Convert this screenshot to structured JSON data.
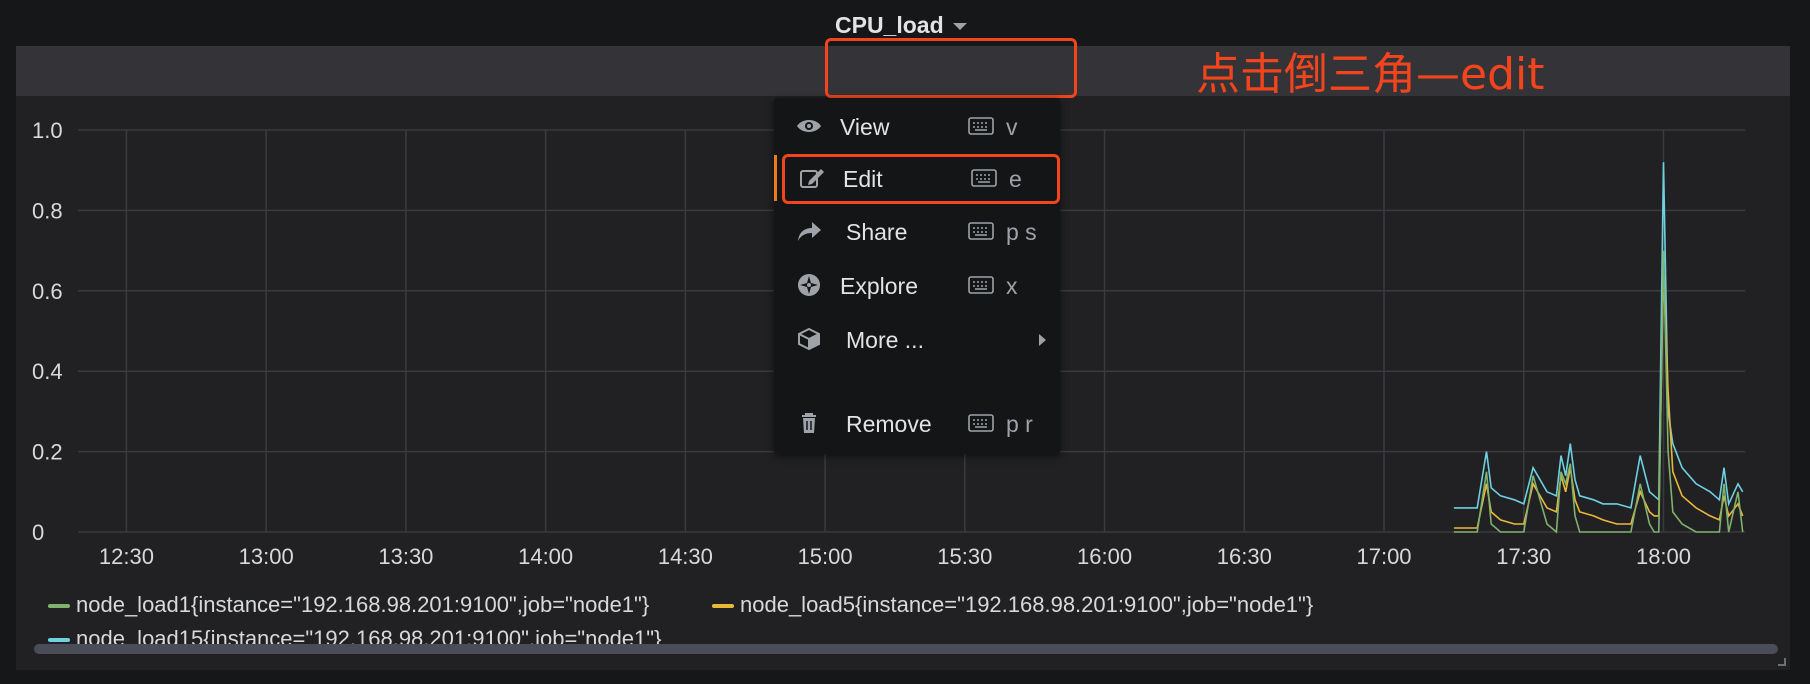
{
  "panel": {
    "title": "CPU_load",
    "annotation": "点击倒三角—edit"
  },
  "menu": {
    "items": [
      {
        "label": "View",
        "shortcut": "v",
        "icon": "eye-icon"
      },
      {
        "label": "Edit",
        "shortcut": "e",
        "icon": "edit-icon"
      },
      {
        "label": "Share",
        "shortcut": "p s",
        "icon": "share-icon"
      },
      {
        "label": "Explore",
        "shortcut": "x",
        "icon": "compass-icon"
      },
      {
        "label": "More ...",
        "shortcut": "",
        "icon": "cube-icon"
      },
      {
        "label": "Remove",
        "shortcut": "p r",
        "icon": "trash-icon"
      }
    ]
  },
  "colors": {
    "load1": "#7eb26d",
    "load5": "#eab839",
    "load15": "#6ed0e0",
    "accent": "#eb7b18",
    "annotation": "#f2441d"
  },
  "chart_data": {
    "type": "line",
    "title": "CPU_load",
    "xlabel": "",
    "ylabel": "",
    "x_ticks": [
      "12:30",
      "13:00",
      "13:30",
      "14:00",
      "14:30",
      "15:00",
      "15:30",
      "16:00",
      "16:30",
      "17:00",
      "17:30",
      "18:00"
    ],
    "y_ticks": [
      "0",
      "0.2",
      "0.4",
      "0.6",
      "0.8",
      "1.0"
    ],
    "ylim": [
      0,
      1.0
    ],
    "grid": true,
    "legend_position": "bottom",
    "x": [
      "17:15",
      "17:20",
      "17:22",
      "17:23",
      "17:25",
      "17:28",
      "17:30",
      "17:32",
      "17:35",
      "17:37",
      "17:38",
      "17:39",
      "17:40",
      "17:41",
      "17:42",
      "17:45",
      "17:47",
      "17:50",
      "17:53",
      "17:55",
      "17:57",
      "17:58",
      "17:59",
      "18:00",
      "18:01",
      "18:02",
      "18:04",
      "18:07",
      "18:10",
      "18:12",
      "18:13",
      "18:14",
      "18:16",
      "18:17"
    ],
    "series": [
      {
        "name": "node_load1{instance=\"192.168.98.201:9100\",job=\"node1\"}",
        "values": [
          0,
          0,
          0.15,
          0.02,
          0,
          0,
          0,
          0.14,
          0.02,
          0,
          0.15,
          0.12,
          0.17,
          0.04,
          0,
          0,
          0,
          0,
          0,
          0.12,
          0.02,
          0,
          0,
          0.7,
          0.2,
          0.05,
          0.02,
          0,
          0,
          0,
          0.12,
          0,
          0.1,
          0
        ]
      },
      {
        "name": "node_load5{instance=\"192.168.98.201:9100\",job=\"node1\"}",
        "values": [
          0.01,
          0.01,
          0.12,
          0.05,
          0.03,
          0.02,
          0.02,
          0.12,
          0.06,
          0.05,
          0.14,
          0.1,
          0.16,
          0.08,
          0.05,
          0.04,
          0.03,
          0.02,
          0.02,
          0.1,
          0.05,
          0.04,
          0.04,
          0.65,
          0.35,
          0.15,
          0.09,
          0.06,
          0.04,
          0.03,
          0.09,
          0.04,
          0.07,
          0.04
        ]
      },
      {
        "name": "node_load15{instance=\"192.168.98.201:9100\",job=\"node1\"}",
        "values": [
          0.06,
          0.06,
          0.2,
          0.11,
          0.09,
          0.08,
          0.07,
          0.16,
          0.1,
          0.09,
          0.19,
          0.14,
          0.22,
          0.13,
          0.09,
          0.08,
          0.07,
          0.07,
          0.06,
          0.19,
          0.1,
          0.09,
          0.08,
          0.92,
          0.3,
          0.22,
          0.16,
          0.12,
          0.1,
          0.08,
          0.16,
          0.07,
          0.12,
          0.1
        ]
      }
    ]
  }
}
